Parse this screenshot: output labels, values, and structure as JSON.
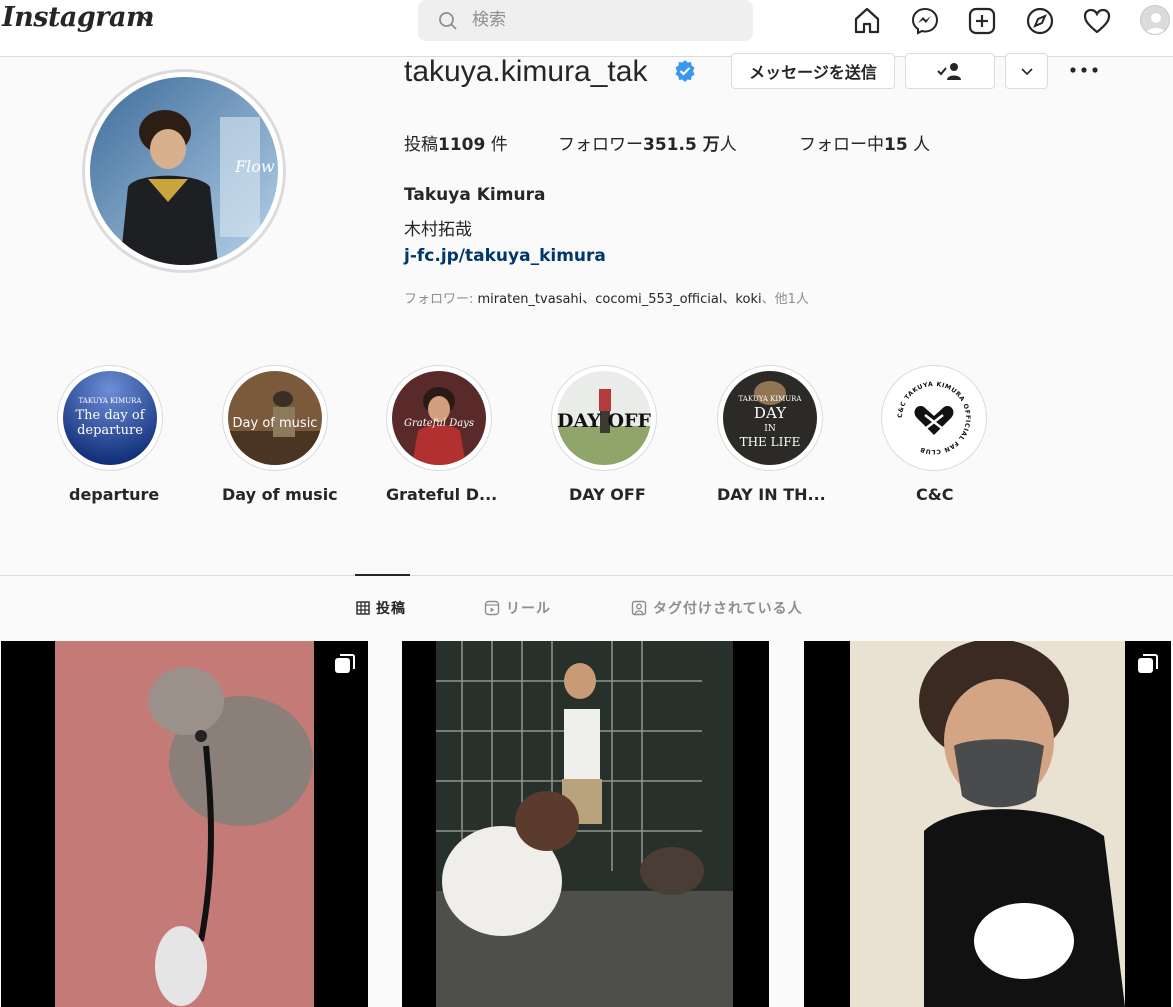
{
  "nav": {
    "logo": "Instagram",
    "search_placeholder": "検索"
  },
  "profile": {
    "username": "takuya.kimura_tak",
    "message_button": "メッセージを送信",
    "stats": {
      "posts_label": "投稿",
      "posts_value": "1109",
      "posts_unit": " 件",
      "followers_label": "フォロワー",
      "followers_value": "351.5 万",
      "followers_unit": "人",
      "following_label": "フォロー中",
      "following_value": "15",
      "following_unit": " 人"
    },
    "full_name": "Takuya Kimura",
    "bio": "木村拓哉",
    "link": "j-fc.jp/takuya_kimura",
    "followed_by_prefix": "フォロワー: ",
    "followed_by_names": "miraten_tvasahi、cocomi_553_official、koki",
    "followed_by_suffix": "、他1人"
  },
  "highlights": [
    {
      "label": "departure",
      "cover_line1": "TAKUYA KIMURA",
      "cover_line2": "The day of",
      "cover_line3": "departure"
    },
    {
      "label": "Day of music",
      "cover_line1": "Day of music"
    },
    {
      "label": "Grateful D...",
      "cover_line1": "Grateful Days"
    },
    {
      "label": "DAY OFF",
      "cover_line1": "DAY OFF"
    },
    {
      "label": "DAY IN TH...",
      "cover_line1": "TAKUYA KIMURA",
      "cover_line2": "DAY",
      "cover_line3": "IN",
      "cover_line4": "THE LIFE"
    },
    {
      "label": "C&C",
      "cover_ring_text": "C&C TAKUYA KIMURA OFFICIAL FAN CLUB"
    }
  ],
  "tabs": [
    {
      "label": "投稿",
      "icon": "grid-icon",
      "active": true
    },
    {
      "label": "リール",
      "icon": "reels-icon",
      "active": false
    },
    {
      "label": "タグ付けされている人",
      "icon": "tagged-icon",
      "active": false
    }
  ],
  "posts": [
    {
      "alt": "poodle walk",
      "multi": true
    },
    {
      "alt": "with dogs",
      "multi": false
    },
    {
      "alt": "selfie",
      "multi": true
    }
  ],
  "colors": {
    "link": "#00376b",
    "verified": "#3897f0",
    "border": "#dbdbdb",
    "muted": "#8e8e8e"
  }
}
